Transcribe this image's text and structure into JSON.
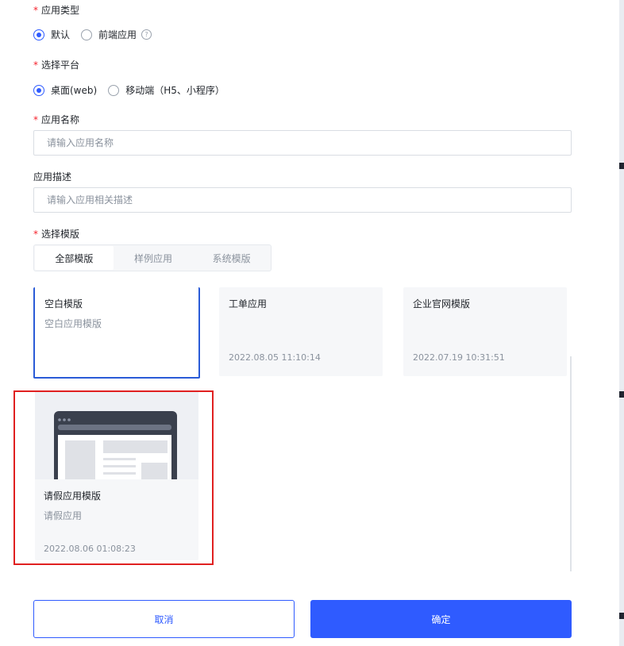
{
  "app_type": {
    "label": "应用类型",
    "options": [
      "默认",
      "前端应用"
    ],
    "selected": 0,
    "help_icon": "question-circle-icon"
  },
  "platform": {
    "label": "选择平台",
    "options": [
      "桌面(web)",
      "移动端（H5、小程序）"
    ],
    "selected": 0
  },
  "app_name": {
    "label": "应用名称",
    "value": "",
    "placeholder": "请输入应用名称"
  },
  "app_desc": {
    "label": "应用描述",
    "value": "",
    "placeholder": "请输入应用相关描述"
  },
  "template": {
    "label": "选择模版",
    "tabs": [
      "全部模版",
      "样例应用",
      "系统模版"
    ],
    "active_tab": 0,
    "cards": [
      {
        "title": "空白模版",
        "desc": "空白应用模版",
        "date": "",
        "selected": true
      },
      {
        "title": "工单应用",
        "desc": "",
        "date": "2022.08.05 11:10:14",
        "selected": false
      },
      {
        "title": "企业官网模版",
        "desc": "",
        "date": "2022.07.19 10:31:51",
        "selected": false
      },
      {
        "title": "请假应用模版",
        "desc": "请假应用",
        "date": "2022.08.06 01:08:23",
        "selected": false,
        "has_thumbnail": true
      }
    ]
  },
  "footer": {
    "cancel_label": "取消",
    "confirm_label": "确定"
  },
  "colors": {
    "primary": "#2f5bff",
    "required": "#f5222d",
    "highlight_box": "#e02020",
    "selected_card_border": "#2a5bd7"
  }
}
